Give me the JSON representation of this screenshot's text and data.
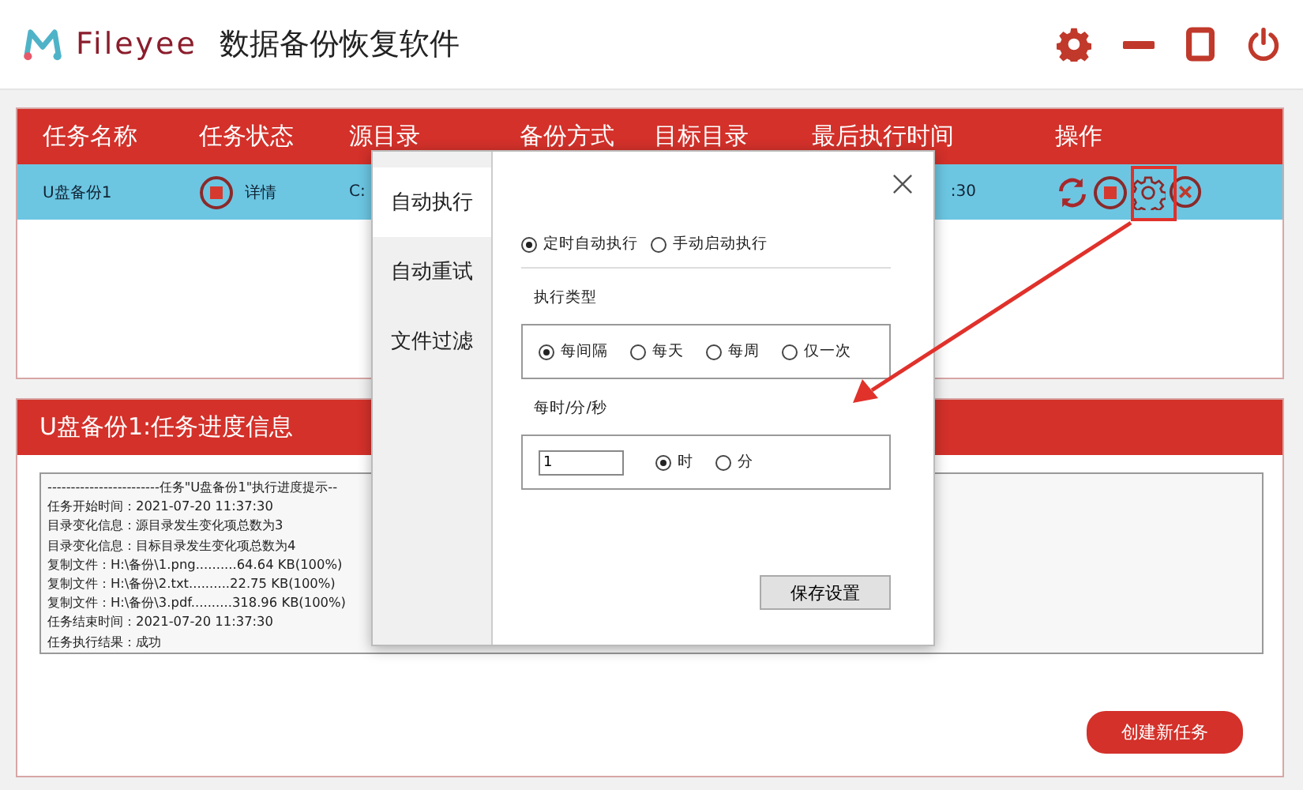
{
  "app": {
    "logo_text": "Fileyee",
    "title": "数据备份恢复软件"
  },
  "task_table": {
    "columns": [
      "任务名称",
      "任务状态",
      "源目录",
      "备份方式",
      "目标目录",
      "最后执行时间",
      "操作"
    ],
    "rows": [
      {
        "name": "U盘备份1",
        "status": "详情",
        "source": "C:",
        "last_run": ":30",
        "selected": true
      }
    ]
  },
  "progress_panel": {
    "title": "U盘备份1:任务进度信息",
    "log_lines": [
      "------------------------任务\"U盘备份1\"执行进度提示--",
      "任务开始时间：2021-07-20 11:37:30",
      "目录变化信息：源目录发生变化项总数为3",
      "目录变化信息：目标目录发生变化项总数为4",
      "复制文件：H:\\备份\\1.png..........64.64 KB(100%)",
      "复制文件：H:\\备份\\2.txt..........22.75 KB(100%)",
      "复制文件：H:\\备份\\3.pdf..........318.96 KB(100%)",
      "任务结束时间：2021-07-20 11:37:30",
      "任务执行结果：成功"
    ]
  },
  "create_button": "创建新任务",
  "dialog": {
    "tabs": [
      {
        "label": "自动执行",
        "selected": true
      },
      {
        "label": "自动重试",
        "selected": false
      },
      {
        "label": "文件过滤",
        "selected": false
      }
    ],
    "run_modes": [
      {
        "label": "定时自动执行",
        "selected": true
      },
      {
        "label": "手动启动执行",
        "selected": false
      }
    ],
    "exec_type": {
      "label": "执行类型",
      "options": [
        {
          "label": "每间隔",
          "selected": true
        },
        {
          "label": "每天",
          "selected": false
        },
        {
          "label": "每周",
          "selected": false
        },
        {
          "label": "仅一次",
          "selected": false
        }
      ]
    },
    "interval": {
      "label": "每时/分/秒",
      "value": "1",
      "units": [
        {
          "label": "时",
          "selected": true
        },
        {
          "label": "分",
          "selected": false
        }
      ]
    },
    "save_button": "保存设置"
  }
}
